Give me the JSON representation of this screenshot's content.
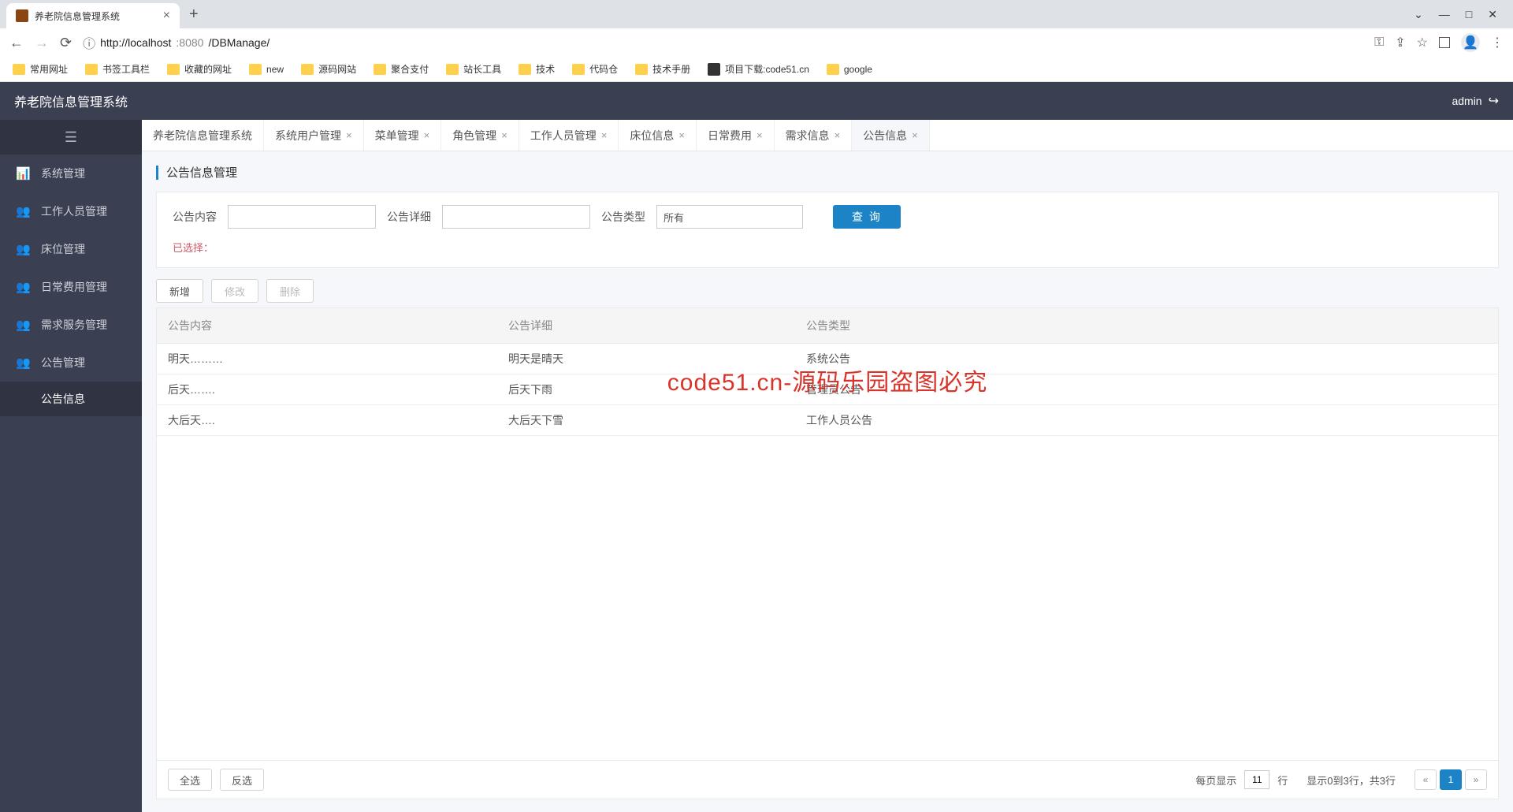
{
  "browser": {
    "tab_title": "养老院信息管理系统",
    "url_host": "http://localhost",
    "url_port": ":8080",
    "url_path": "/DBManage/",
    "bookmarks": [
      {
        "label": "常用网址",
        "type": "folder"
      },
      {
        "label": "书签工具栏",
        "type": "folder"
      },
      {
        "label": "收藏的网址",
        "type": "folder"
      },
      {
        "label": "new",
        "type": "folder"
      },
      {
        "label": "源码网站",
        "type": "folder"
      },
      {
        "label": "聚合支付",
        "type": "folder"
      },
      {
        "label": "站长工具",
        "type": "folder"
      },
      {
        "label": "技术",
        "type": "folder"
      },
      {
        "label": "代码仓",
        "type": "folder"
      },
      {
        "label": "技术手册",
        "type": "folder"
      },
      {
        "label": "项目下载:code51.cn",
        "type": "link"
      },
      {
        "label": "google",
        "type": "folder"
      }
    ]
  },
  "app": {
    "title": "养老院信息管理系统",
    "user": "admin"
  },
  "sidebar": {
    "items": [
      {
        "icon": "chart-bar",
        "label": "系统管理"
      },
      {
        "icon": "users",
        "label": "工作人员管理"
      },
      {
        "icon": "users",
        "label": "床位管理"
      },
      {
        "icon": "users",
        "label": "日常费用管理"
      },
      {
        "icon": "users",
        "label": "需求服务管理"
      },
      {
        "icon": "users",
        "label": "公告管理"
      }
    ],
    "subitem": "公告信息"
  },
  "tabs": [
    {
      "label": "养老院信息管理系统",
      "closable": false
    },
    {
      "label": "系统用户管理",
      "closable": true
    },
    {
      "label": "菜单管理",
      "closable": true
    },
    {
      "label": "角色管理",
      "closable": true
    },
    {
      "label": "工作人员管理",
      "closable": true
    },
    {
      "label": "床位信息",
      "closable": true
    },
    {
      "label": "日常费用",
      "closable": true
    },
    {
      "label": "需求信息",
      "closable": true
    },
    {
      "label": "公告信息",
      "closable": true,
      "active": true
    }
  ],
  "page": {
    "title": "公告信息管理",
    "filters": {
      "content_label": "公告内容",
      "detail_label": "公告详细",
      "type_label": "公告类型",
      "type_value": "所有",
      "query_btn": "查 询",
      "selected_label": "已选择："
    },
    "actions": {
      "add": "新增",
      "edit": "修改",
      "delete": "删除"
    },
    "table": {
      "headers": [
        "公告内容",
        "公告详细",
        "公告类型"
      ],
      "rows": [
        {
          "c1": "明天………",
          "c2": "明天是晴天",
          "c3": "系统公告"
        },
        {
          "c1": "后天…….",
          "c2": "后天下雨",
          "c3": "管理员公告"
        },
        {
          "c1": "大后天….",
          "c2": "大后天下雪",
          "c3": "工作人员公告"
        }
      ]
    },
    "footer": {
      "select_all": "全选",
      "invert": "反选",
      "page_size_prefix": "每页显示",
      "page_size_value": "11",
      "page_size_suffix": "行",
      "summary": "显示0到3行，共3行",
      "current_page": "1"
    }
  },
  "watermark": "code51.cn-源码乐园盗图必究"
}
